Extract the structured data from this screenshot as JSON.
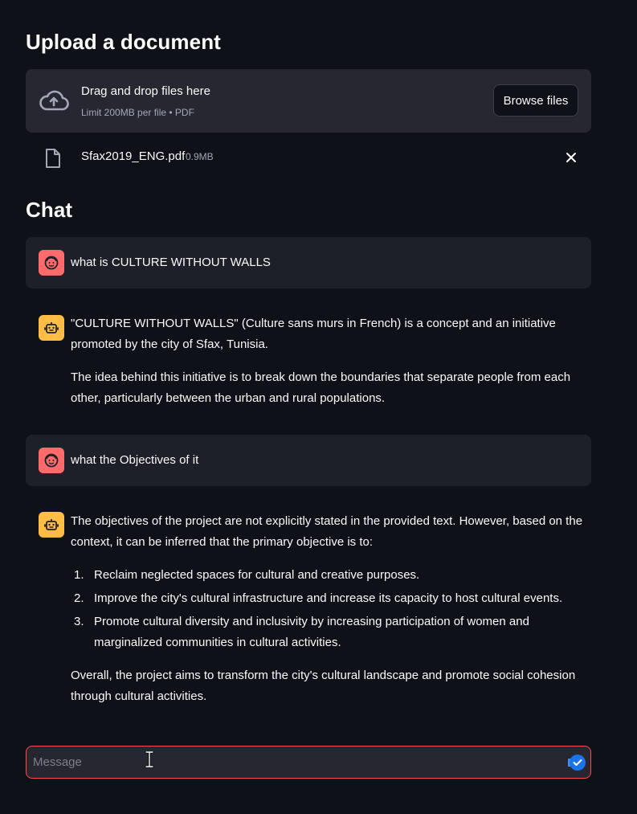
{
  "upload": {
    "heading": "Upload a document",
    "drop_title": "Drag and drop files here",
    "drop_limit": "Limit 200MB per file • PDF",
    "browse_label": "Browse files",
    "file_name": "Sfax2019_ENG.pdf",
    "file_size": "0.9MB"
  },
  "chat": {
    "heading": "Chat",
    "q1": "what is CULTURE WITHOUT WALLS",
    "a1_p1_l1": "\"CULTURE WITHOUT WALLS\" (Culture sans murs in French) is a concept and an initiative",
    "a1_p1_l2": "promoted by the city of Sfax, Tunisia.",
    "a1_p2_l1": "The idea behind this initiative is to break down the boundaries that separate people from each",
    "a1_p2_l2": "other, particularly between the urban and rural populations.",
    "q2": "what the Objectives of it",
    "a2_intro_l1": "The objectives of the project are not explicitly stated in the provided text. However, based on the",
    "a2_intro_l2": "context, it can be inferred that the primary objective is to:",
    "a2_items": [
      {
        "num": "1.",
        "l1": "Reclaim neglected spaces for cultural and creative purposes.",
        "l2": ""
      },
      {
        "num": "2.",
        "l1": "Improve the city's cultural infrastructure and increase its capacity to host cultural events.",
        "l2": ""
      },
      {
        "num": "3.",
        "l1": "Promote cultural diversity and inclusivity by increasing participation of women and",
        "l2": "marginalized communities in cultural activities."
      }
    ],
    "a2_outro_l1": "Overall, the project aims to transform the city's cultural landscape and promote social cohesion",
    "a2_outro_l2": "through cultural activities.",
    "input_placeholder": "Message"
  },
  "colors": {
    "background": "#0e1117",
    "user_avatar": "#ff6b6b",
    "bot_avatar": "#ffbd45",
    "input_focus_border": "#ff4b4b",
    "send_badge": "#1a73e8"
  },
  "icons": [
    "cloud-upload-icon",
    "document-icon",
    "close-icon",
    "user-face-icon",
    "robot-icon",
    "send-check-icon",
    "text-cursor-icon"
  ]
}
